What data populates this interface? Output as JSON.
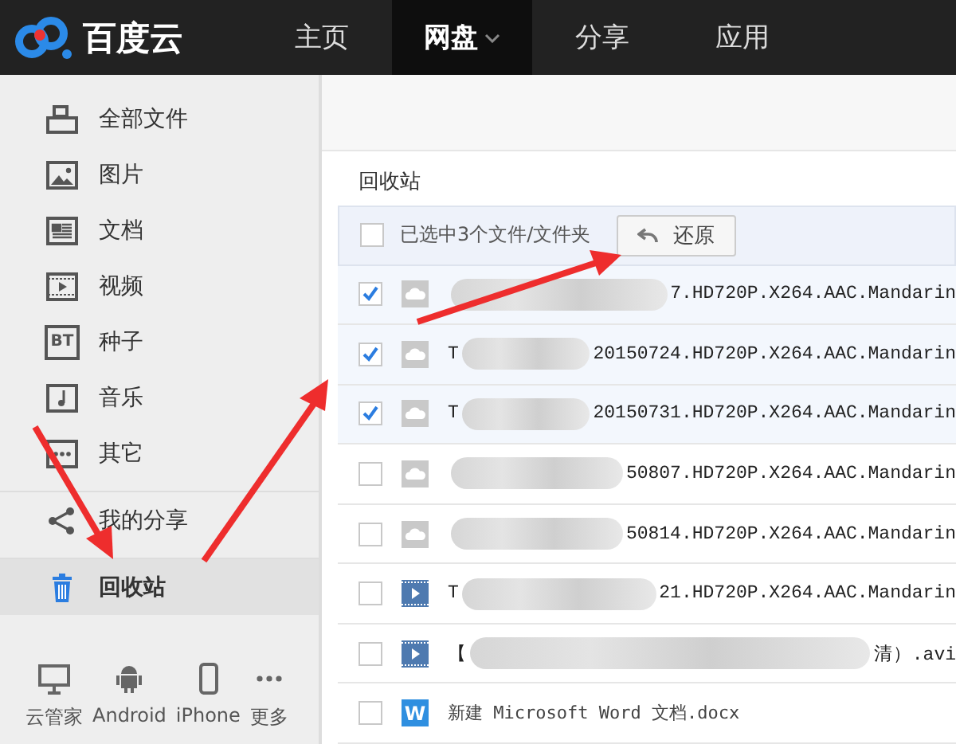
{
  "brand": {
    "name": "百度云"
  },
  "nav": [
    {
      "label": "主页",
      "selected": false,
      "dropdown": false
    },
    {
      "label": "网盘",
      "selected": true,
      "dropdown": true
    },
    {
      "label": "分享",
      "selected": false,
      "dropdown": false
    },
    {
      "label": "应用",
      "selected": false,
      "dropdown": false
    }
  ],
  "sidebar": {
    "categories": [
      {
        "kind": "all",
        "label": "全部文件",
        "selected": false
      },
      {
        "kind": "image",
        "label": "图片",
        "selected": false
      },
      {
        "kind": "doc",
        "label": "文档",
        "selected": false
      },
      {
        "kind": "video",
        "label": "视频",
        "selected": false
      },
      {
        "kind": "bt",
        "label": "种子",
        "badge": "BT",
        "selected": false
      },
      {
        "kind": "music",
        "label": "音乐",
        "selected": false
      },
      {
        "kind": "other",
        "label": "其它",
        "selected": false
      }
    ],
    "share": {
      "label": "我的分享",
      "selected": false
    },
    "trash": {
      "label": "回收站",
      "selected": true
    },
    "clients": [
      {
        "kind": "desktop",
        "label": "云管家"
      },
      {
        "kind": "android",
        "label": "Android"
      },
      {
        "kind": "phone",
        "label": "iPhone"
      },
      {
        "kind": "more",
        "label": "更多"
      }
    ]
  },
  "breadcrumb": "回收站",
  "list_header": {
    "select_all": false,
    "summary": "已选中3个文件/文件夹",
    "restore_button": "还原"
  },
  "files": [
    {
      "kind": "cloud",
      "checked": true,
      "tail": "7.HD720P.X264.AAC.Mandarin"
    },
    {
      "kind": "cloud",
      "checked": true,
      "lead": "T",
      "tail": "20150724.HD720P.X264.AAC.Mandarin"
    },
    {
      "kind": "cloud",
      "checked": true,
      "lead": "T",
      "tail": "20150731.HD720P.X264.AAC.Mandarin"
    },
    {
      "kind": "cloud",
      "checked": false,
      "tail": "50807.HD720P.X264.AAC.Mandarin"
    },
    {
      "kind": "cloud",
      "checked": false,
      "tail": "50814.HD720P.X264.AAC.Mandarin"
    },
    {
      "kind": "video",
      "checked": false,
      "lead": "T",
      "tail": "21.HD720P.X264.AAC.Mandarin"
    },
    {
      "kind": "video",
      "checked": false,
      "lead": "【",
      "tail": "清）.avi"
    },
    {
      "kind": "word",
      "checked": false,
      "icon_label": "W",
      "name": "新建 Microsoft Word 文档.docx"
    }
  ]
}
